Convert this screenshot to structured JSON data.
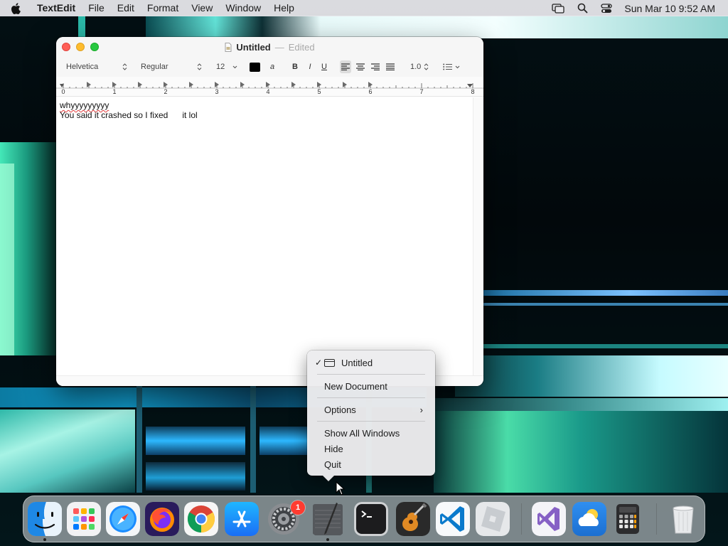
{
  "menubar": {
    "apple_icon": "apple-logo-icon",
    "app_name": "TextEdit",
    "items": [
      "File",
      "Edit",
      "Format",
      "View",
      "Window",
      "Help"
    ],
    "status_icons": [
      "screen-mirroring-icon",
      "spotlight-search-icon",
      "control-center-icon"
    ],
    "clock": "Sun Mar 10  9:52 AM"
  },
  "window": {
    "title": "Untitled",
    "separator": "—",
    "state": "Edited",
    "formatbar": {
      "font_family": "Helvetica",
      "font_style": "Regular",
      "font_size": "12",
      "text_color": "#000000",
      "highlight_label": "a",
      "bold_label": "B",
      "italic_label": "I",
      "underline_label": "U",
      "line_spacing": "1.0",
      "list_icon": "bullet-list-icon"
    },
    "ruler": {
      "numbers": [
        "0",
        "1",
        "2",
        "3",
        "4",
        "5",
        "6",
        "7",
        "8"
      ]
    },
    "content": {
      "line1": "whyyyyyyyyy",
      "line2": "You said it crashed so I fixed      it lol"
    }
  },
  "dock_menu": {
    "items": [
      {
        "label": "Untitled",
        "checked": true,
        "icon": "window-icon"
      },
      {
        "label": "New Document"
      },
      {
        "label": "Options",
        "submenu": true
      },
      {
        "label": "Show All Windows"
      },
      {
        "label": "Hide"
      },
      {
        "label": "Quit"
      }
    ],
    "check_mark": "✓",
    "submenu_arrow": "›"
  },
  "dock": {
    "apps": [
      {
        "name": "Finder",
        "icon": "finder-icon",
        "running": true
      },
      {
        "name": "Launchpad",
        "icon": "launchpad-icon",
        "running": false
      },
      {
        "name": "Safari",
        "icon": "safari-icon",
        "running": false
      },
      {
        "name": "Firefox",
        "icon": "firefox-icon",
        "running": false
      },
      {
        "name": "Chrome",
        "icon": "chrome-icon",
        "running": false
      },
      {
        "name": "App Store",
        "icon": "app-store-icon",
        "running": false
      },
      {
        "name": "System Settings",
        "icon": "system-settings-icon",
        "running": false,
        "badge": "1"
      },
      {
        "name": "TextEdit",
        "icon": "textedit-icon",
        "running": true
      },
      {
        "name": "Terminal",
        "icon": "terminal-icon",
        "running": false
      },
      {
        "name": "GarageBand",
        "icon": "garageband-icon",
        "running": false
      },
      {
        "name": "Visual Studio Code",
        "icon": "vscode-icon",
        "running": false
      },
      {
        "name": "Roblox",
        "icon": "roblox-icon",
        "running": false
      },
      {
        "name": "Visual Studio",
        "icon": "visual-studio-icon",
        "running": false
      },
      {
        "name": "Weather",
        "icon": "weather-icon",
        "running": false
      },
      {
        "name": "Calculator",
        "icon": "calculator-icon",
        "running": false
      },
      {
        "name": "Trash",
        "icon": "trash-icon",
        "running": false
      }
    ]
  }
}
